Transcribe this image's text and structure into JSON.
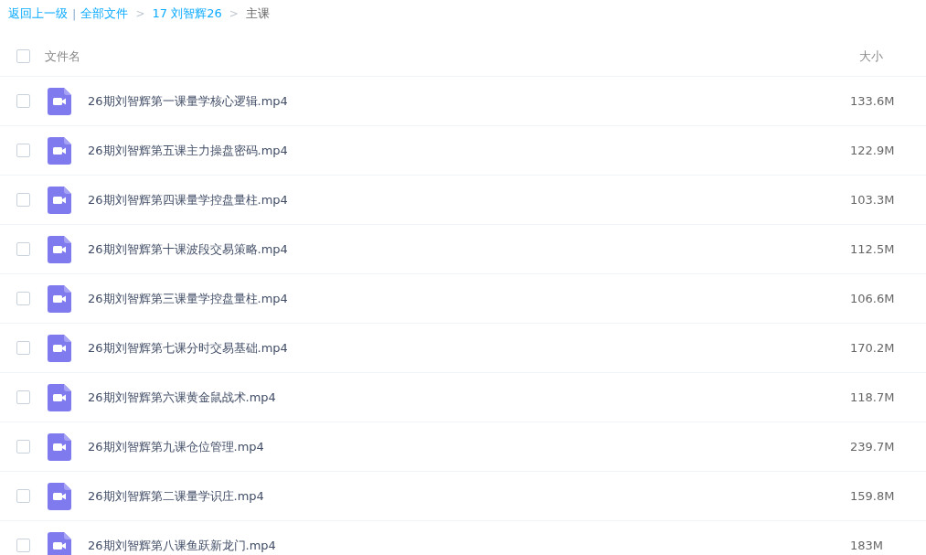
{
  "breadcrumb": [
    {
      "kind": "link",
      "label": "返回上一级"
    },
    {
      "kind": "divider",
      "label": "|"
    },
    {
      "kind": "link",
      "label": "全部文件"
    },
    {
      "kind": "separator",
      "label": ">"
    },
    {
      "kind": "link",
      "label": "17 刘智辉26"
    },
    {
      "kind": "separator",
      "label": ">"
    },
    {
      "kind": "current",
      "label": "主课"
    }
  ],
  "table": {
    "select_all": {
      "checked": false
    },
    "columns": [
      "文件名",
      "大小"
    ],
    "rows": [
      {
        "name": "26期刘智辉第一课量学核心逻辑.mp4",
        "size": "133.6M",
        "checked": false
      },
      {
        "name": "26期刘智辉第五课主力操盘密码.mp4",
        "size": "122.9M",
        "checked": false
      },
      {
        "name": "26期刘智辉第四课量学控盘量柱.mp4",
        "size": "103.3M",
        "checked": false
      },
      {
        "name": "26期刘智辉第十课波段交易策略.mp4",
        "size": "112.5M",
        "checked": false
      },
      {
        "name": "26期刘智辉第三课量学控盘量柱.mp4",
        "size": "106.6M",
        "checked": false
      },
      {
        "name": "26期刘智辉第七课分时交易基础.mp4",
        "size": "170.2M",
        "checked": false
      },
      {
        "name": "26期刘智辉第六课黄金鼠战术.mp4",
        "size": "118.7M",
        "checked": false
      },
      {
        "name": "26期刘智辉第九课仓位管理.mp4",
        "size": "239.7M",
        "checked": false
      },
      {
        "name": "26期刘智辉第二课量学识庄.mp4",
        "size": "159.8M",
        "checked": false
      },
      {
        "name": "26期刘智辉第八课鱼跃新龙门.mp4",
        "size": "183M",
        "checked": false
      }
    ]
  }
}
